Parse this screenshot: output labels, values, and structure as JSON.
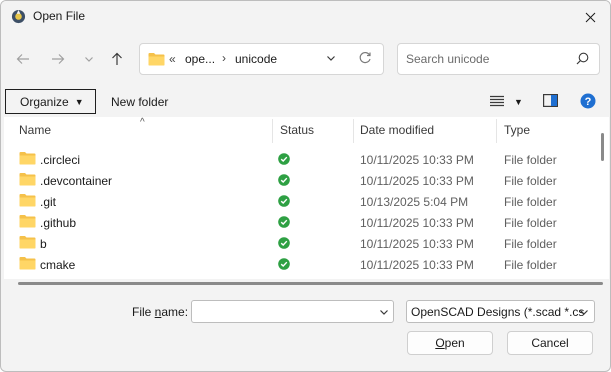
{
  "window": {
    "title": "Open File"
  },
  "address": {
    "folder_icon": "folder-icon",
    "overflow": "«",
    "segment1": "ope...",
    "separator": "›",
    "segment2": "unicode"
  },
  "search": {
    "placeholder": "Search unicode"
  },
  "toolbar": {
    "organize_label": "Organize",
    "new_folder_label": "New folder"
  },
  "columns": {
    "name": "Name",
    "status": "Status",
    "date": "Date modified",
    "type": "Type"
  },
  "files": [
    {
      "name": ".circleci",
      "date": "10/11/2025 10:33 PM",
      "type": "File folder"
    },
    {
      "name": ".devcontainer",
      "date": "10/11/2025 10:33 PM",
      "type": "File folder"
    },
    {
      "name": ".git",
      "date": "10/13/2025 5:04 PM",
      "type": "File folder"
    },
    {
      "name": ".github",
      "date": "10/11/2025 10:33 PM",
      "type": "File folder"
    },
    {
      "name": "b",
      "date": "10/11/2025 10:33 PM",
      "type": "File folder"
    },
    {
      "name": "cmake",
      "date": "10/11/2025 10:33 PM",
      "type": "File folder"
    }
  ],
  "bottom": {
    "file_name_label_pre": "File ",
    "file_name_label_u": "n",
    "file_name_label_post": "ame:",
    "file_name_value": "",
    "filter": "OpenSCAD Designs (*.scad *.cs",
    "open_label_u": "O",
    "open_label_rest": "pen",
    "cancel_label": "Cancel"
  },
  "colors": {
    "folder": "#f5c14a",
    "status_ok": "#2ea043",
    "help": "#1f6fd1",
    "accent": "#0067c0"
  }
}
